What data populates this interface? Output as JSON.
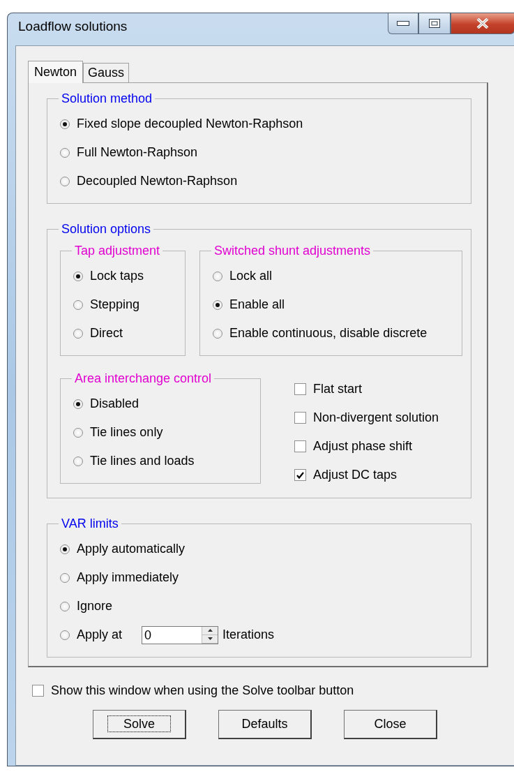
{
  "window": {
    "title": "Loadflow solutions"
  },
  "tabs": [
    {
      "label": "Newton",
      "selected": true
    },
    {
      "label": "Gauss",
      "selected": false
    }
  ],
  "solution_method": {
    "title": "Solution method",
    "options": [
      {
        "label": "Fixed slope decoupled Newton-Raphson",
        "selected": true
      },
      {
        "label": "Full Newton-Raphson",
        "selected": false
      },
      {
        "label": "Decoupled Newton-Raphson",
        "selected": false
      }
    ]
  },
  "solution_options": {
    "title": "Solution options",
    "tap_adjustment": {
      "title": "Tap adjustment",
      "options": [
        {
          "label": "Lock taps",
          "selected": true
        },
        {
          "label": "Stepping",
          "selected": false
        },
        {
          "label": "Direct",
          "selected": false
        }
      ]
    },
    "switched_shunt_adjustments": {
      "title": "Switched shunt adjustments",
      "options": [
        {
          "label": "Lock all",
          "selected": false
        },
        {
          "label": "Enable all",
          "selected": true
        },
        {
          "label": "Enable continuous, disable discrete",
          "selected": false
        }
      ]
    },
    "area_interchange_control": {
      "title": "Area interchange control",
      "options": [
        {
          "label": "Disabled",
          "selected": true
        },
        {
          "label": "Tie lines only",
          "selected": false
        },
        {
          "label": "Tie lines and loads",
          "selected": false
        }
      ]
    },
    "checkboxes": [
      {
        "label": "Flat start",
        "checked": false
      },
      {
        "label": "Non-divergent solution",
        "checked": false
      },
      {
        "label": "Adjust phase shift",
        "checked": false
      },
      {
        "label": "Adjust DC taps",
        "checked": true
      }
    ]
  },
  "var_limits": {
    "title": "VAR limits",
    "options": [
      {
        "kind": "plain",
        "label": "Apply automatically",
        "selected": true
      },
      {
        "kind": "plain",
        "label": "Apply immediately",
        "selected": false
      },
      {
        "kind": "plain",
        "label": "Ignore",
        "selected": false
      },
      {
        "kind": "with_field",
        "label": "Apply at",
        "selected": false,
        "value": "0",
        "unit": "Iterations"
      }
    ]
  },
  "show_window": {
    "label": "Show this window when using the Solve toolbar button",
    "checked": false
  },
  "buttons": [
    {
      "label": "Solve",
      "focused": true
    },
    {
      "label": "Defaults",
      "focused": false
    },
    {
      "label": "Close",
      "focused": false
    }
  ]
}
